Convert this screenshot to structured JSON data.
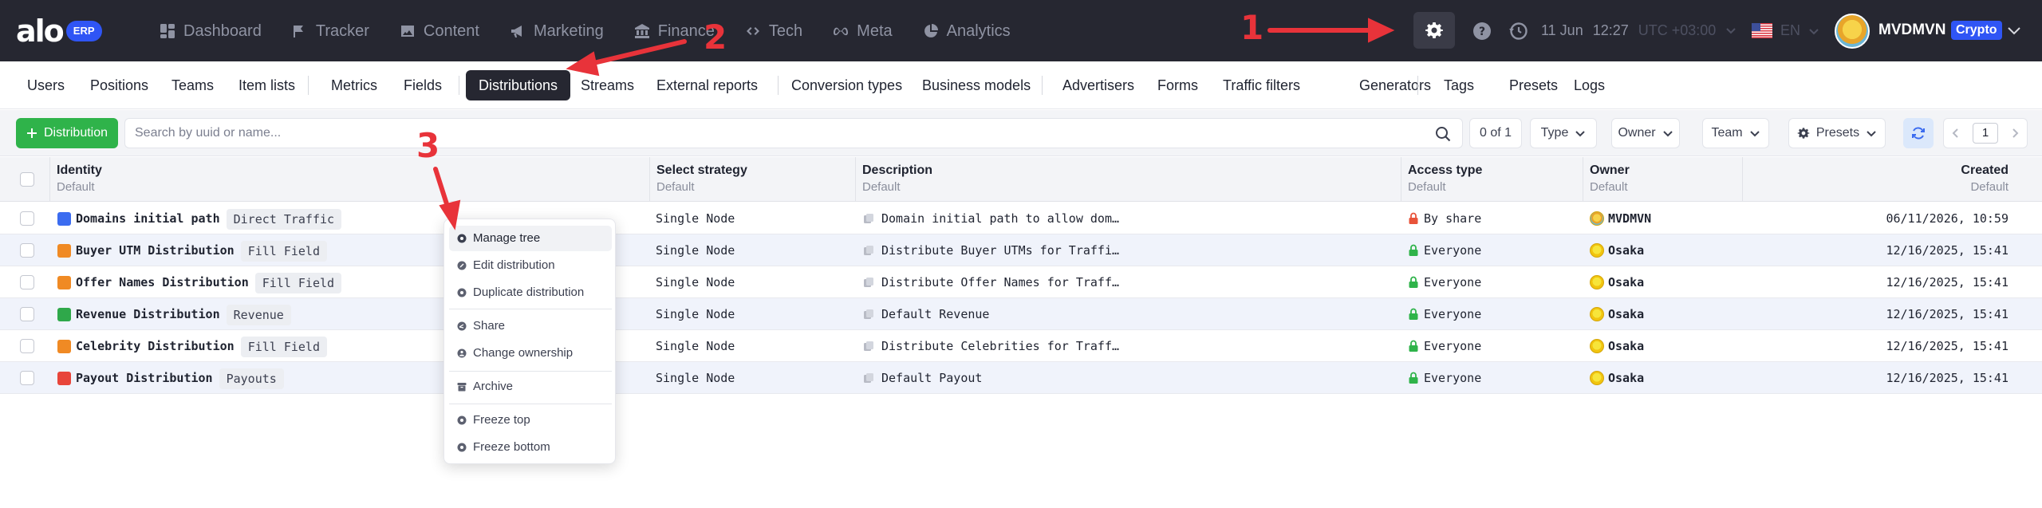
{
  "app": {
    "logo_text": "alo",
    "logo_badge": "ERP",
    "nav": [
      {
        "label": "Dashboard",
        "icon": "dashboard-icon"
      },
      {
        "label": "Tracker",
        "icon": "tracker-icon"
      },
      {
        "label": "Content",
        "icon": "image-icon"
      },
      {
        "label": "Marketing",
        "icon": "marketing-icon"
      },
      {
        "label": "Finance",
        "icon": "finance-icon"
      },
      {
        "label": "Tech",
        "icon": "tech-icon"
      },
      {
        "label": "Meta",
        "icon": "meta-icon"
      },
      {
        "label": "Analytics",
        "icon": "analytics-icon"
      }
    ],
    "date": "11 Jun",
    "time": "12:27",
    "timezone": "UTC +03:00",
    "language": "EN",
    "user": "MVDMVN",
    "account_badge": "Crypto"
  },
  "subnav": [
    {
      "label": "Users"
    },
    {
      "label": "Positions"
    },
    {
      "label": "Teams"
    },
    {
      "label": "Item lists"
    },
    {
      "label": "Metrics"
    },
    {
      "label": "Fields"
    },
    {
      "label": "Distributions",
      "active": true
    },
    {
      "label": "Streams"
    },
    {
      "label": "External reports"
    },
    {
      "label": "Conversion types"
    },
    {
      "label": "Business models"
    },
    {
      "label": "Advertisers"
    },
    {
      "label": "Forms"
    },
    {
      "label": "Traffic filters"
    },
    {
      "label": "Generators"
    },
    {
      "label": "Tags"
    },
    {
      "label": "Presets"
    },
    {
      "label": "Logs"
    }
  ],
  "toolbar": {
    "add_label": "Distribution",
    "search_placeholder": "Search by uuid or name...",
    "count": "0 of 1",
    "filters": [
      "Type",
      "Owner",
      "Team"
    ],
    "presets_label": "Presets",
    "page": "1"
  },
  "table": {
    "columns": [
      {
        "title": "Identity",
        "sub": "Default"
      },
      {
        "title": "Select strategy",
        "sub": "Default"
      },
      {
        "title": "Description",
        "sub": "Default"
      },
      {
        "title": "Access type",
        "sub": "Default"
      },
      {
        "title": "Owner",
        "sub": "Default"
      },
      {
        "title": "Created",
        "sub": "Default"
      }
    ],
    "rows": [
      {
        "name": "Domains initial path",
        "tag": "Direct Traffic",
        "strategy": "Single Node",
        "description": "Domain initial path to allow dom…",
        "access": "By share",
        "owner": "MVDMVN",
        "created": "06/11/2026, 10:59",
        "icon_color": "#3b6cf0",
        "lock_color": "#e8533a"
      },
      {
        "name": "Buyer UTM Distribution",
        "tag": "Fill Field",
        "strategy": "Single Node",
        "description": "Distribute Buyer UTMs for Traffi…",
        "access": "Everyone",
        "owner": "Osaka",
        "created": "12/16/2025, 15:41",
        "icon_color": "#f08a24",
        "lock_color": "#2fb34a"
      },
      {
        "name": "Offer Names Distribution",
        "tag": "Fill Field",
        "strategy": "Single Node",
        "description": "Distribute Offer Names for Traff…",
        "access": "Everyone",
        "owner": "Osaka",
        "created": "12/16/2025, 15:41",
        "icon_color": "#f08a24",
        "lock_color": "#2fb34a"
      },
      {
        "name": "Revenue Distribution",
        "tag": "Revenue",
        "strategy": "Single Node",
        "description": "Default Revenue",
        "access": "Everyone",
        "owner": "Osaka",
        "created": "12/16/2025, 15:41",
        "icon_color": "#2fa84a",
        "lock_color": "#2fb34a"
      },
      {
        "name": "Celebrity Distribution",
        "tag": "Fill Field",
        "strategy": "Single Node",
        "description": "Distribute Celebrities for Traff…",
        "access": "Everyone",
        "owner": "Osaka",
        "created": "12/16/2025, 15:41",
        "icon_color": "#f08a24",
        "lock_color": "#2fb34a"
      },
      {
        "name": "Payout Distribution",
        "tag": "Payouts",
        "strategy": "Single Node",
        "description": "Default Payout",
        "access": "Everyone",
        "owner": "Osaka",
        "created": "12/16/2025, 15:41",
        "icon_color": "#e8453a",
        "lock_color": "#2fb34a"
      }
    ]
  },
  "context_menu": {
    "items": [
      {
        "label": "Manage tree",
        "icon": "tree-icon"
      },
      {
        "label": "Edit distribution",
        "icon": "edit-icon"
      },
      {
        "label": "Duplicate distribution",
        "icon": "duplicate-icon"
      },
      {
        "label": "Share",
        "icon": "share-icon"
      },
      {
        "label": "Change ownership",
        "icon": "ownership-icon"
      },
      {
        "label": "Archive",
        "icon": "archive-icon"
      },
      {
        "label": "Freeze top",
        "icon": "freeze-top-icon"
      },
      {
        "label": "Freeze bottom",
        "icon": "freeze-bottom-icon"
      }
    ]
  },
  "annotations": [
    "1",
    "2",
    "3"
  ],
  "colors": {
    "topbar": "#262731",
    "accent_blue": "#2f55f5",
    "add_green": "#2fb34a",
    "annotation_red": "#e8333a"
  }
}
